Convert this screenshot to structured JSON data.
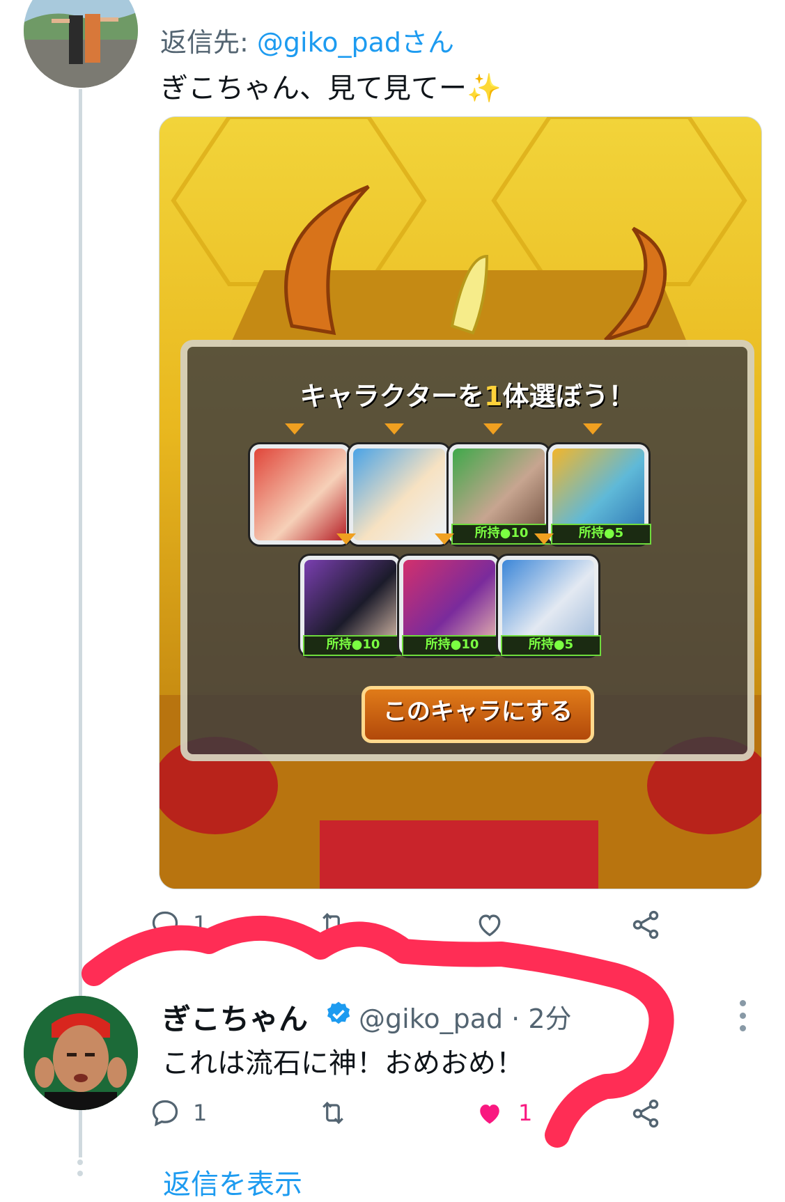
{
  "tweet1": {
    "reply_label": "返信先:",
    "reply_mention": "@giko_padさん",
    "text": "ぎこちゃん、見て見てー",
    "emoji": "✨",
    "media": {
      "panel_title_prefix": "キャラクターを",
      "panel_title_highlight": "1",
      "panel_title_suffix": "体選ぼう！",
      "characters": [
        {
          "tag": ""
        },
        {
          "tag": ""
        },
        {
          "tag": "所持●10"
        },
        {
          "tag": "所持●5"
        },
        {
          "tag": "所持●10"
        },
        {
          "tag": "所持●10"
        },
        {
          "tag": "所持●5"
        }
      ],
      "confirm_button": "このキャラにする"
    },
    "actions": {
      "reply_count": "1",
      "retweet_count": "",
      "like_count": ""
    }
  },
  "tweet2": {
    "name": "ぎこちゃん",
    "handle_time": "@giko_pad · 2分",
    "text": "これは流石に神！おめおめ！",
    "actions": {
      "reply_count": "1",
      "retweet_count": "",
      "like_count": "1"
    }
  },
  "show_replies": "返信を表示",
  "colors": {
    "accent": "#1d9bf0",
    "like": "#f91880",
    "scribble": "#ff2d55"
  }
}
